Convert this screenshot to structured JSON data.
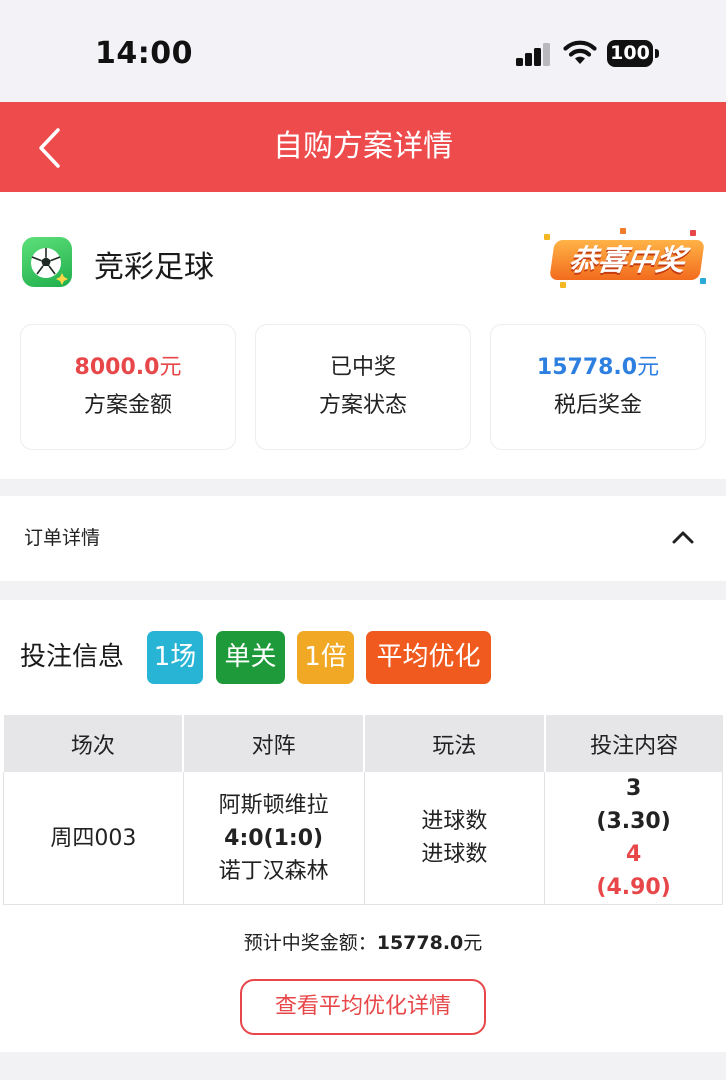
{
  "status_bar": {
    "time": "14:00",
    "battery": "100"
  },
  "nav": {
    "title": "自购方案详情",
    "back_icon": "chevron-left-icon"
  },
  "lottery": {
    "name": "竞彩足球",
    "logo_icon": "soccer-ball-icon",
    "badge": "恭喜中奖"
  },
  "stats": {
    "amount": {
      "value": "8000.0",
      "unit": "元",
      "label": "方案金额",
      "color": "#e8474a"
    },
    "status": {
      "value": "已中奖",
      "label": "方案状态"
    },
    "prize": {
      "value": "15778.0",
      "unit": "元",
      "label": "税后奖金",
      "color": "#2d7fe0"
    }
  },
  "order": {
    "title": "订单详情",
    "toggle_icon": "chevron-up-icon"
  },
  "bet": {
    "title": "投注信息",
    "tags": [
      {
        "label": "1场",
        "color": "#28b4d4"
      },
      {
        "label": "单关",
        "color": "#1f9a3a"
      },
      {
        "label": "1倍",
        "color": "#f1a824"
      },
      {
        "label": "平均优化",
        "color": "#f05a1f"
      }
    ],
    "table": {
      "headers": [
        "场次",
        "对阵",
        "玩法",
        "投注内容"
      ],
      "row": {
        "match_no": "周四003",
        "home": "阿斯顿维拉",
        "score": "4:0(1:0)",
        "away": "诺丁汉森林",
        "play1": "进球数",
        "play2": "进球数",
        "pick1": "3",
        "odds1": "(3.30)",
        "pick2": "4",
        "odds2": "(4.90)"
      }
    },
    "expected_label": "预计中奖金额：",
    "expected_value": "15778.0",
    "expected_unit": "元",
    "detail_button": "查看平均优化详情"
  }
}
